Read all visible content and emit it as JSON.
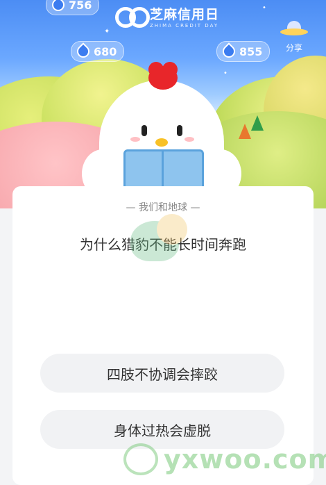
{
  "header": {
    "logo_main": "芝麻信用日",
    "logo_sub": "ZHIMA CREDIT DAY",
    "badges": [
      "756",
      "680",
      "855"
    ],
    "share_label": "分享"
  },
  "quiz": {
    "category": "— 我们和地球 —",
    "question": "为什么猎豹不能长时间奔跑",
    "options": [
      "四肢不协调会摔跤",
      "身体过热会虚脱"
    ]
  },
  "watermark": {
    "text": "yxwoo.com"
  },
  "colors": {
    "sky": "#4c8df4",
    "comb": "#e8262a",
    "option_bg": "#f1f2f4",
    "card_bg": "#ffffff"
  }
}
